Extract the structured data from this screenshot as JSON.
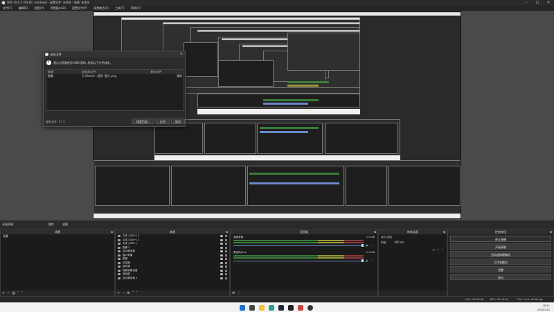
{
  "window": {
    "title": "OBS 29.0.2 (64-bit, windows) - 配置文件: 未命名 - 场景: 未命名",
    "minimize": "–",
    "maximize": "□",
    "close": "✕"
  },
  "menu": [
    "文件(F)",
    "编辑(E)",
    "视图(V)",
    "停靠窗口(D)",
    "配置文件(P)",
    "场景集合(S)",
    "工具(T)",
    "帮助(H)"
  ],
  "dialog": {
    "title": "缺失文件",
    "close": "✕",
    "message": "我认为您要使用 OBS 源码, 检测以下文件缺失。",
    "columns": [
      "来源",
      "缺失的文件",
      "新的文件"
    ],
    "row": {
      "source": "图像",
      "file": "C:/Users/.../图片-图片.png",
      "action": "清除"
    },
    "status": "缺失文件: 1 / 1",
    "buttons": [
      "搜索目录...",
      "应用",
      "取消"
    ]
  },
  "dock_header": {
    "label": "未选择源",
    "properties": "属性",
    "filters": "滤镜"
  },
  "panels": {
    "scenes": {
      "title": "场景",
      "items": [
        "场景"
      ]
    },
    "sources": {
      "title": "来源",
      "items": [
        "文本 (GDI+) 3",
        "文本 (GDI+) 2",
        "文本 (GDI+)",
        "图像 2",
        "显示器采集",
        "窗口采集",
        "图像",
        "浏览器",
        "游戏源",
        "视频采集设备",
        "音频源",
        "显示器采集 2"
      ]
    },
    "mixer": {
      "title": "混音器",
      "channels": [
        {
          "name": "桌面音频",
          "db": "0.0 dB"
        },
        {
          "name": "麦克风/Aux",
          "db": "0.0 dB"
        }
      ]
    },
    "transitions": {
      "title": "转场动画",
      "type": "淡入淡出",
      "duration_label": "时长",
      "duration": "300 ms"
    },
    "controls": {
      "title": "控制按钮",
      "buttons": [
        "停止直播",
        "开始录制",
        "启动虚拟摄像机",
        "工作室模式",
        "设置",
        "退出"
      ]
    }
  },
  "statusbar": {
    "live": "LIVE: 00:00:00",
    "rec": "REC: 00:00:00",
    "cpu": "CPU: 4.1%, 60.00 fps"
  },
  "taskbar": {
    "time": "18:51",
    "date": "2023/1/22"
  },
  "colors": {
    "accent": "#6a8ac8",
    "meter_green": "#3a7d3a",
    "meter_yellow": "#9a9a3a",
    "meter_red": "#8a3a3a"
  }
}
